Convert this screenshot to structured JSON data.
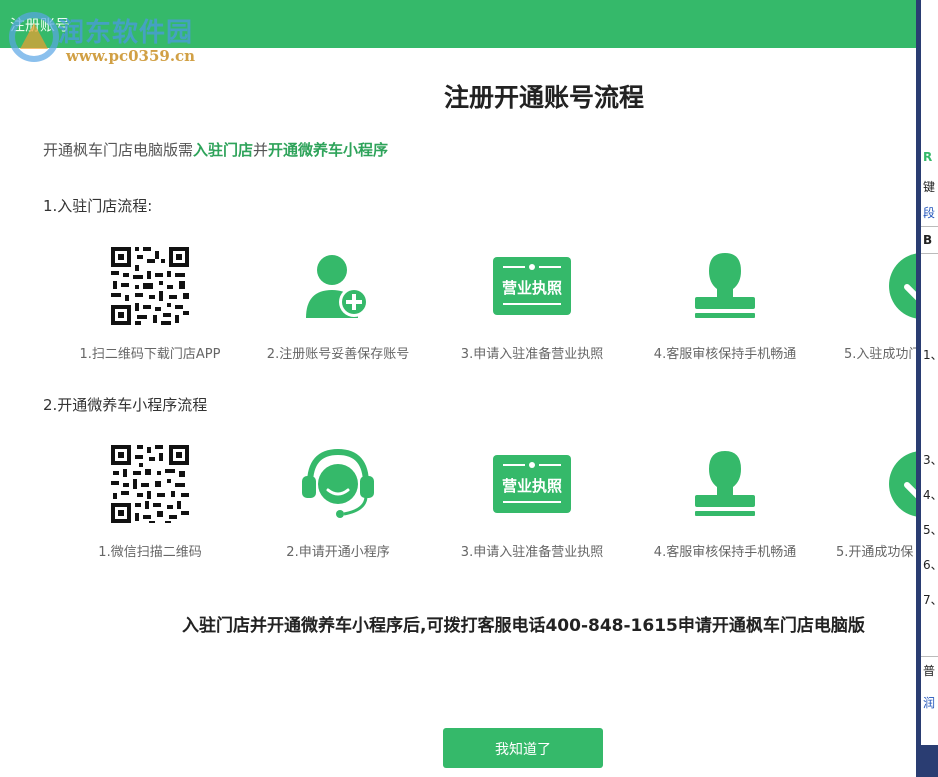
{
  "dialog": {
    "title": "注册账号",
    "watermark": {
      "name": "润东软件园",
      "url": "www.pc0359.cn"
    },
    "heading": "注册开通账号流程",
    "intro": {
      "prefix": "开通枫车门店电脑版需",
      "hl1": "入驻门店",
      "mid": "并",
      "hl2": "开通微养车小程序"
    },
    "section1": {
      "title": "1.入驻门店流程:",
      "steps": [
        {
          "label": "1.扫二维码下载门店APP",
          "icon": "qr-code-icon"
        },
        {
          "label": "2.注册账号妥善保存账号",
          "icon": "user-add-icon"
        },
        {
          "label": "3.申请入驻准备营业执照",
          "icon": "business-license-icon",
          "icon_text": "营业执照"
        },
        {
          "label": "4.客服审核保持手机畅通",
          "icon": "stamp-icon"
        },
        {
          "label": "5.入驻成功门",
          "icon": "check-circle-icon"
        }
      ]
    },
    "section2": {
      "title": "2.开通微养车小程序流程",
      "steps": [
        {
          "label": "1.微信扫描二维码",
          "icon": "qr-code-icon"
        },
        {
          "label": "2.申请开通小程序",
          "icon": "headset-agent-icon"
        },
        {
          "label": "3.申请入驻准备营业执照",
          "icon": "business-license-icon",
          "icon_text": "营业执照"
        },
        {
          "label": "4.客服审核保持手机畅通",
          "icon": "stamp-icon"
        },
        {
          "label": "5.开通成功保",
          "icon": "check-circle-icon"
        }
      ]
    },
    "footer_note": "入驻门店并开通微养车小程序后,可拨打客服电话400-848-1615申请开通枫车门店电脑版",
    "ok_button": "我知道了",
    "accent_color": "#35b96a"
  },
  "background_window": {
    "cells": [
      "键",
      "段",
      "B",
      "1、",
      "3、",
      "4、",
      "5、",
      "6、",
      "7、",
      "普",
      "润"
    ]
  }
}
